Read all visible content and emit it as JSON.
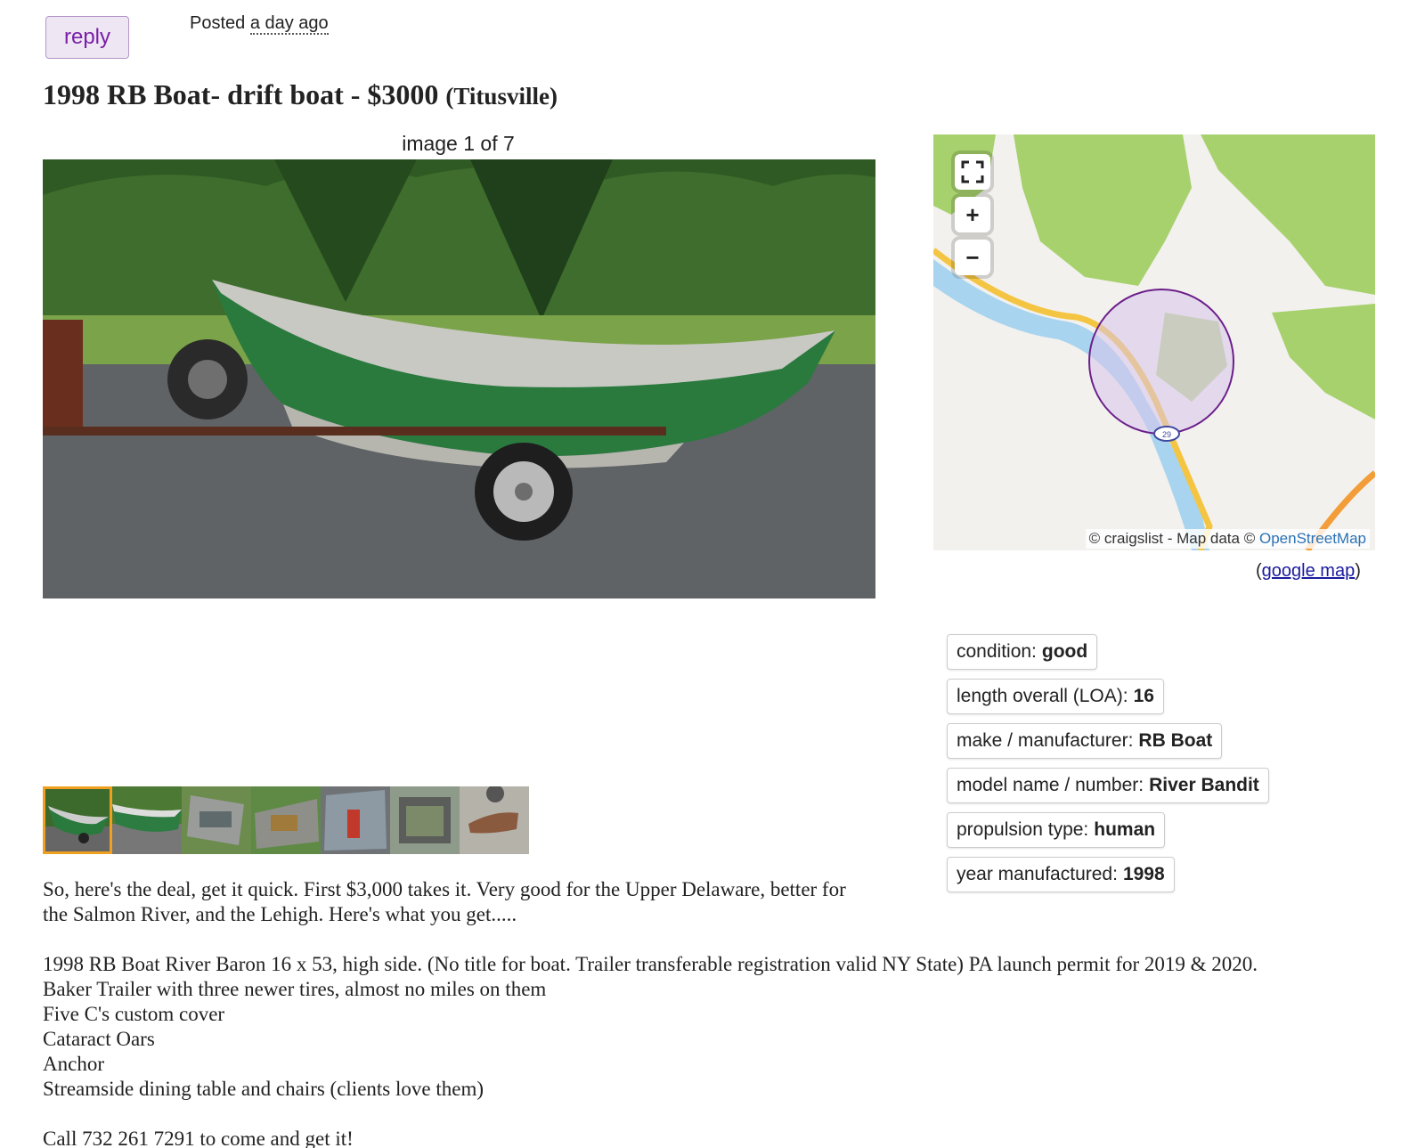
{
  "header": {
    "reply_label": "reply",
    "posted_prefix": "Posted",
    "posted_time": "a day ago"
  },
  "posting": {
    "title": "1998 RB Boat- drift boat - $3000",
    "location": "(Titusville)"
  },
  "gallery": {
    "counter": "image 1 of 7",
    "thumb_count": 7,
    "active_index": 0
  },
  "map": {
    "zoom_in": "+",
    "zoom_out": "−",
    "attribution_prefix": "© craigslist - Map data ©",
    "attribution_link": "OpenStreetMap",
    "route_badge": "29",
    "google_open": "(",
    "google_link": "google map",
    "google_close": ")"
  },
  "attributes": [
    {
      "label": "condition:",
      "value": "good"
    },
    {
      "label": "length overall (LOA):",
      "value": "16"
    },
    {
      "label": "make / manufacturer:",
      "value": "RB Boat"
    },
    {
      "label": "model name / number:",
      "value": "River Bandit"
    },
    {
      "label": "propulsion type:",
      "value": "human"
    },
    {
      "label": "year manufactured:",
      "value": "1998"
    }
  ],
  "body": {
    "lines": [
      "So, here's the deal, get it quick. First $3,000 takes it. Very good for the Upper Delaware, better for",
      "the Salmon River, and the Lehigh. Here's what you get.....",
      "1998 RB Boat River Baron 16 x 53, high side. (No title for boat. Trailer transferable registration valid NY State) PA launch permit for 2019 & 2020.",
      "Baker Trailer with three newer tires, almost no miles on them",
      "Five C's custom cover",
      "Cataract Oars",
      "Anchor",
      "Streamside dining table and chairs (clients love them)",
      "Call 732 261 7291 to come and get it!"
    ]
  },
  "colors": {
    "reply_bg": "#eee6f3",
    "reply_text": "#7a20a8",
    "link": "#1b1b9f",
    "thumb_active": "#f0a020"
  }
}
